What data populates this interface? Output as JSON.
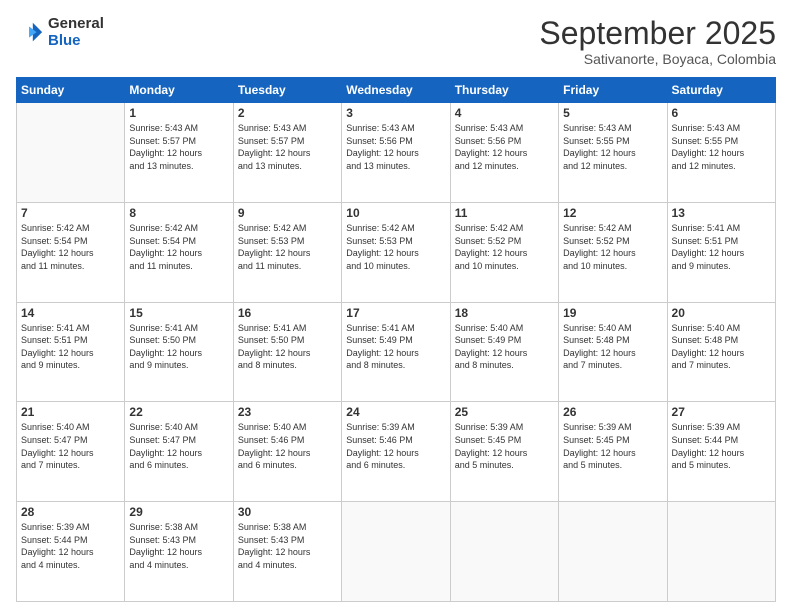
{
  "logo": {
    "general": "General",
    "blue": "Blue"
  },
  "header": {
    "month": "September 2025",
    "location": "Sativanorte, Boyaca, Colombia"
  },
  "days_of_week": [
    "Sunday",
    "Monday",
    "Tuesday",
    "Wednesday",
    "Thursday",
    "Friday",
    "Saturday"
  ],
  "weeks": [
    [
      {
        "day": "",
        "info": ""
      },
      {
        "day": "1",
        "info": "Sunrise: 5:43 AM\nSunset: 5:57 PM\nDaylight: 12 hours\nand 13 minutes."
      },
      {
        "day": "2",
        "info": "Sunrise: 5:43 AM\nSunset: 5:57 PM\nDaylight: 12 hours\nand 13 minutes."
      },
      {
        "day": "3",
        "info": "Sunrise: 5:43 AM\nSunset: 5:56 PM\nDaylight: 12 hours\nand 13 minutes."
      },
      {
        "day": "4",
        "info": "Sunrise: 5:43 AM\nSunset: 5:56 PM\nDaylight: 12 hours\nand 12 minutes."
      },
      {
        "day": "5",
        "info": "Sunrise: 5:43 AM\nSunset: 5:55 PM\nDaylight: 12 hours\nand 12 minutes."
      },
      {
        "day": "6",
        "info": "Sunrise: 5:43 AM\nSunset: 5:55 PM\nDaylight: 12 hours\nand 12 minutes."
      }
    ],
    [
      {
        "day": "7",
        "info": "Sunrise: 5:42 AM\nSunset: 5:54 PM\nDaylight: 12 hours\nand 11 minutes."
      },
      {
        "day": "8",
        "info": "Sunrise: 5:42 AM\nSunset: 5:54 PM\nDaylight: 12 hours\nand 11 minutes."
      },
      {
        "day": "9",
        "info": "Sunrise: 5:42 AM\nSunset: 5:53 PM\nDaylight: 12 hours\nand 11 minutes."
      },
      {
        "day": "10",
        "info": "Sunrise: 5:42 AM\nSunset: 5:53 PM\nDaylight: 12 hours\nand 10 minutes."
      },
      {
        "day": "11",
        "info": "Sunrise: 5:42 AM\nSunset: 5:52 PM\nDaylight: 12 hours\nand 10 minutes."
      },
      {
        "day": "12",
        "info": "Sunrise: 5:42 AM\nSunset: 5:52 PM\nDaylight: 12 hours\nand 10 minutes."
      },
      {
        "day": "13",
        "info": "Sunrise: 5:41 AM\nSunset: 5:51 PM\nDaylight: 12 hours\nand 9 minutes."
      }
    ],
    [
      {
        "day": "14",
        "info": "Sunrise: 5:41 AM\nSunset: 5:51 PM\nDaylight: 12 hours\nand 9 minutes."
      },
      {
        "day": "15",
        "info": "Sunrise: 5:41 AM\nSunset: 5:50 PM\nDaylight: 12 hours\nand 9 minutes."
      },
      {
        "day": "16",
        "info": "Sunrise: 5:41 AM\nSunset: 5:50 PM\nDaylight: 12 hours\nand 8 minutes."
      },
      {
        "day": "17",
        "info": "Sunrise: 5:41 AM\nSunset: 5:49 PM\nDaylight: 12 hours\nand 8 minutes."
      },
      {
        "day": "18",
        "info": "Sunrise: 5:40 AM\nSunset: 5:49 PM\nDaylight: 12 hours\nand 8 minutes."
      },
      {
        "day": "19",
        "info": "Sunrise: 5:40 AM\nSunset: 5:48 PM\nDaylight: 12 hours\nand 7 minutes."
      },
      {
        "day": "20",
        "info": "Sunrise: 5:40 AM\nSunset: 5:48 PM\nDaylight: 12 hours\nand 7 minutes."
      }
    ],
    [
      {
        "day": "21",
        "info": "Sunrise: 5:40 AM\nSunset: 5:47 PM\nDaylight: 12 hours\nand 7 minutes."
      },
      {
        "day": "22",
        "info": "Sunrise: 5:40 AM\nSunset: 5:47 PM\nDaylight: 12 hours\nand 6 minutes."
      },
      {
        "day": "23",
        "info": "Sunrise: 5:40 AM\nSunset: 5:46 PM\nDaylight: 12 hours\nand 6 minutes."
      },
      {
        "day": "24",
        "info": "Sunrise: 5:39 AM\nSunset: 5:46 PM\nDaylight: 12 hours\nand 6 minutes."
      },
      {
        "day": "25",
        "info": "Sunrise: 5:39 AM\nSunset: 5:45 PM\nDaylight: 12 hours\nand 5 minutes."
      },
      {
        "day": "26",
        "info": "Sunrise: 5:39 AM\nSunset: 5:45 PM\nDaylight: 12 hours\nand 5 minutes."
      },
      {
        "day": "27",
        "info": "Sunrise: 5:39 AM\nSunset: 5:44 PM\nDaylight: 12 hours\nand 5 minutes."
      }
    ],
    [
      {
        "day": "28",
        "info": "Sunrise: 5:39 AM\nSunset: 5:44 PM\nDaylight: 12 hours\nand 4 minutes."
      },
      {
        "day": "29",
        "info": "Sunrise: 5:38 AM\nSunset: 5:43 PM\nDaylight: 12 hours\nand 4 minutes."
      },
      {
        "day": "30",
        "info": "Sunrise: 5:38 AM\nSunset: 5:43 PM\nDaylight: 12 hours\nand 4 minutes."
      },
      {
        "day": "",
        "info": ""
      },
      {
        "day": "",
        "info": ""
      },
      {
        "day": "",
        "info": ""
      },
      {
        "day": "",
        "info": ""
      }
    ]
  ]
}
